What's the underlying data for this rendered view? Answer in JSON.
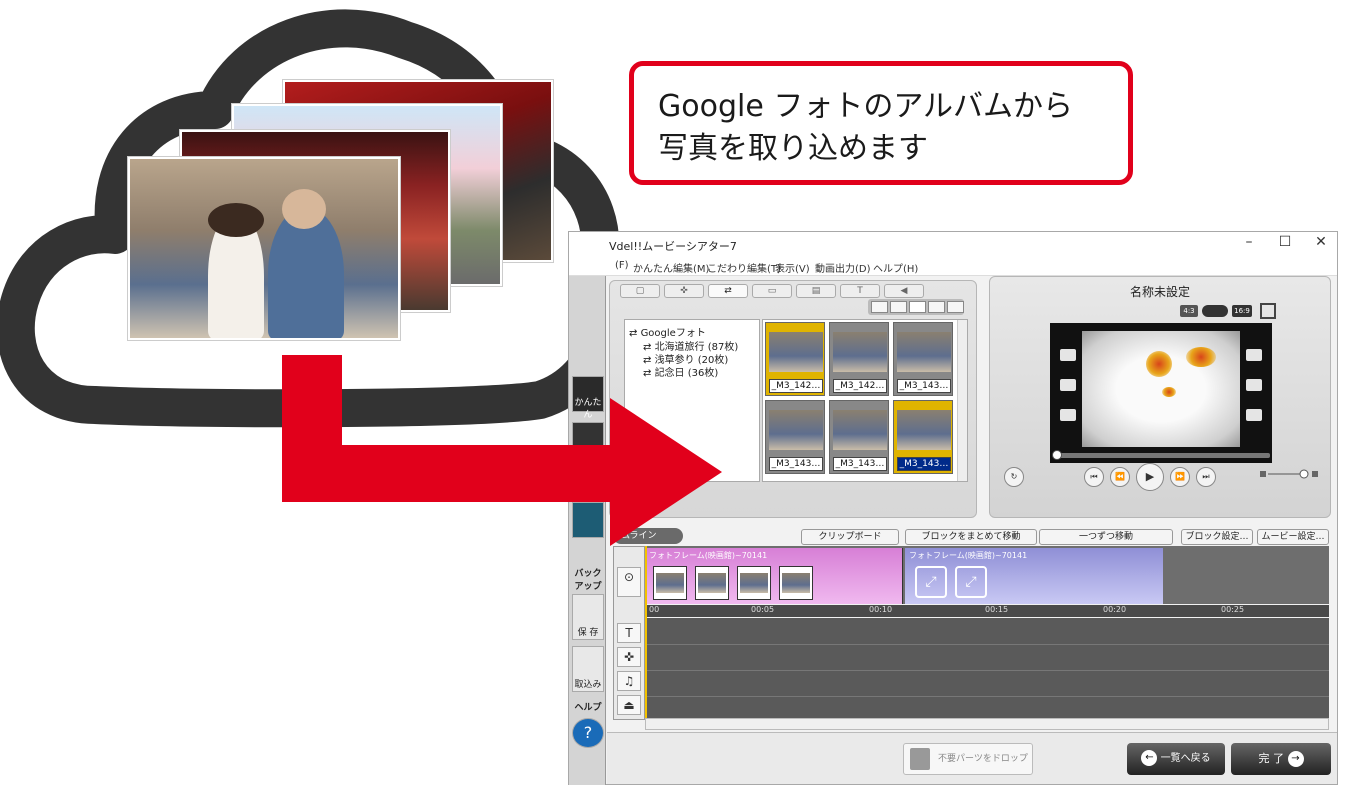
{
  "callout": {
    "line1": "Google フォトのアルバムから",
    "line2": "写真を取り込めます"
  },
  "colors": {
    "accent_red": "#e1001b",
    "cloud": "#333333"
  },
  "window": {
    "title": "Vdel!!ムービーシアター7",
    "menu": [
      "(F)",
      "かんたん編集(M)",
      "こだわり編集(T)",
      "表示(V)",
      "動画出力(D)",
      "ヘルプ(H)"
    ],
    "controls": {
      "minimize": "–",
      "maximize": "☐",
      "close": "✕"
    }
  },
  "left_strip": {
    "kantan": "かんたん",
    "backup": "バック アップ",
    "save": "保 存",
    "import": "取込み",
    "help": "ヘルプ",
    "help_icon": "?"
  },
  "media_tabs": [
    "▢",
    "✜",
    "⇄",
    "▭",
    "▤",
    "T",
    "◀"
  ],
  "tree": {
    "root": "Googleフォト",
    "albums": [
      "北海道旅行 (87枚)",
      "浅草参り (20枚)",
      "記念日 (36枚)"
    ]
  },
  "thumbnails": [
    {
      "label": "_M3_142…",
      "state": "selected-yellow"
    },
    {
      "label": "_M3_142…",
      "state": "normal"
    },
    {
      "label": "_M3_143…",
      "state": "normal"
    },
    {
      "label": "_M3_143…",
      "state": "normal"
    },
    {
      "label": "_M3_143…",
      "state": "normal"
    },
    {
      "label": "_M3_143…",
      "state": "selected-blue"
    }
  ],
  "preview": {
    "title": "名称未設定",
    "ratio_43": "4:3",
    "ratio_169": "16:9",
    "controls": [
      "⏮",
      "⏪",
      "▶",
      "⏩",
      "⏭"
    ]
  },
  "timeline": {
    "tab": "ムライン",
    "buttons": {
      "clipboard": "クリップボード",
      "move_block": "ブロックをまとめて移動",
      "move_one": "一つずつ移動",
      "block_settings": "ブロック設定…",
      "movie_settings": "ムービー設定…"
    },
    "clip1_label": "フォトフレーム(映画館)~70141",
    "clip2_label": "フォトフレーム(映画館)~70141",
    "ruler": [
      "00",
      "00:05",
      "00:10",
      "00:15",
      "00:20",
      "00:25"
    ],
    "tools": [
      "T",
      "✜",
      "♫",
      "⏏"
    ]
  },
  "bottom": {
    "trash": "不要パーツをドロップ",
    "back": "一覧へ戻る",
    "done": "完 了"
  }
}
